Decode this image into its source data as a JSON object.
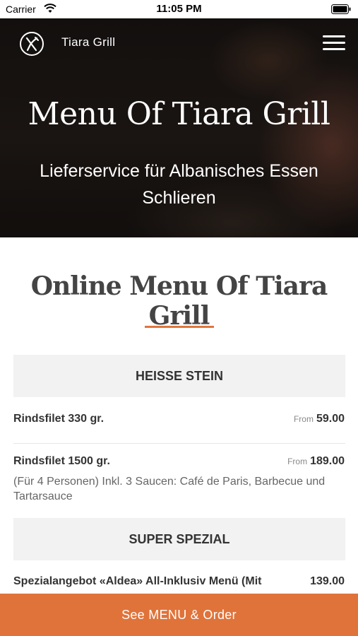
{
  "status_bar": {
    "carrier": "Carrier",
    "time": "11:05 PM"
  },
  "header": {
    "brand": "Tiara Grill"
  },
  "hero": {
    "title": "Menu Of Tiara Grill",
    "subtitle": "Lieferservice für Albanisches Essen Schlieren"
  },
  "menu": {
    "section_title": "Online Menu Of Tiara Grill",
    "categories": [
      {
        "name": "HEISSE STEIN",
        "items": [
          {
            "name": "Rindsfilet 330 gr.",
            "from": "From",
            "price": "59.00",
            "description": ""
          },
          {
            "name": "Rindsfilet 1500 gr.",
            "from": "From",
            "price": "189.00",
            "description": "(Für 4 Personen) Inkl. 3 Saucen: Café de Paris, Barbecue und Tartarsauce"
          }
        ]
      },
      {
        "name": "SUPER SPEZIAL",
        "items": [
          {
            "name": "Spezialangebot «Aldea» All-Inklusiv Menü (Mit",
            "price": "139.00"
          }
        ]
      }
    ]
  },
  "order_button": {
    "label": "See MENU & Order"
  },
  "colors": {
    "accent": "#e0733a",
    "category_bg": "#f2f2f2",
    "text": "#333333"
  }
}
